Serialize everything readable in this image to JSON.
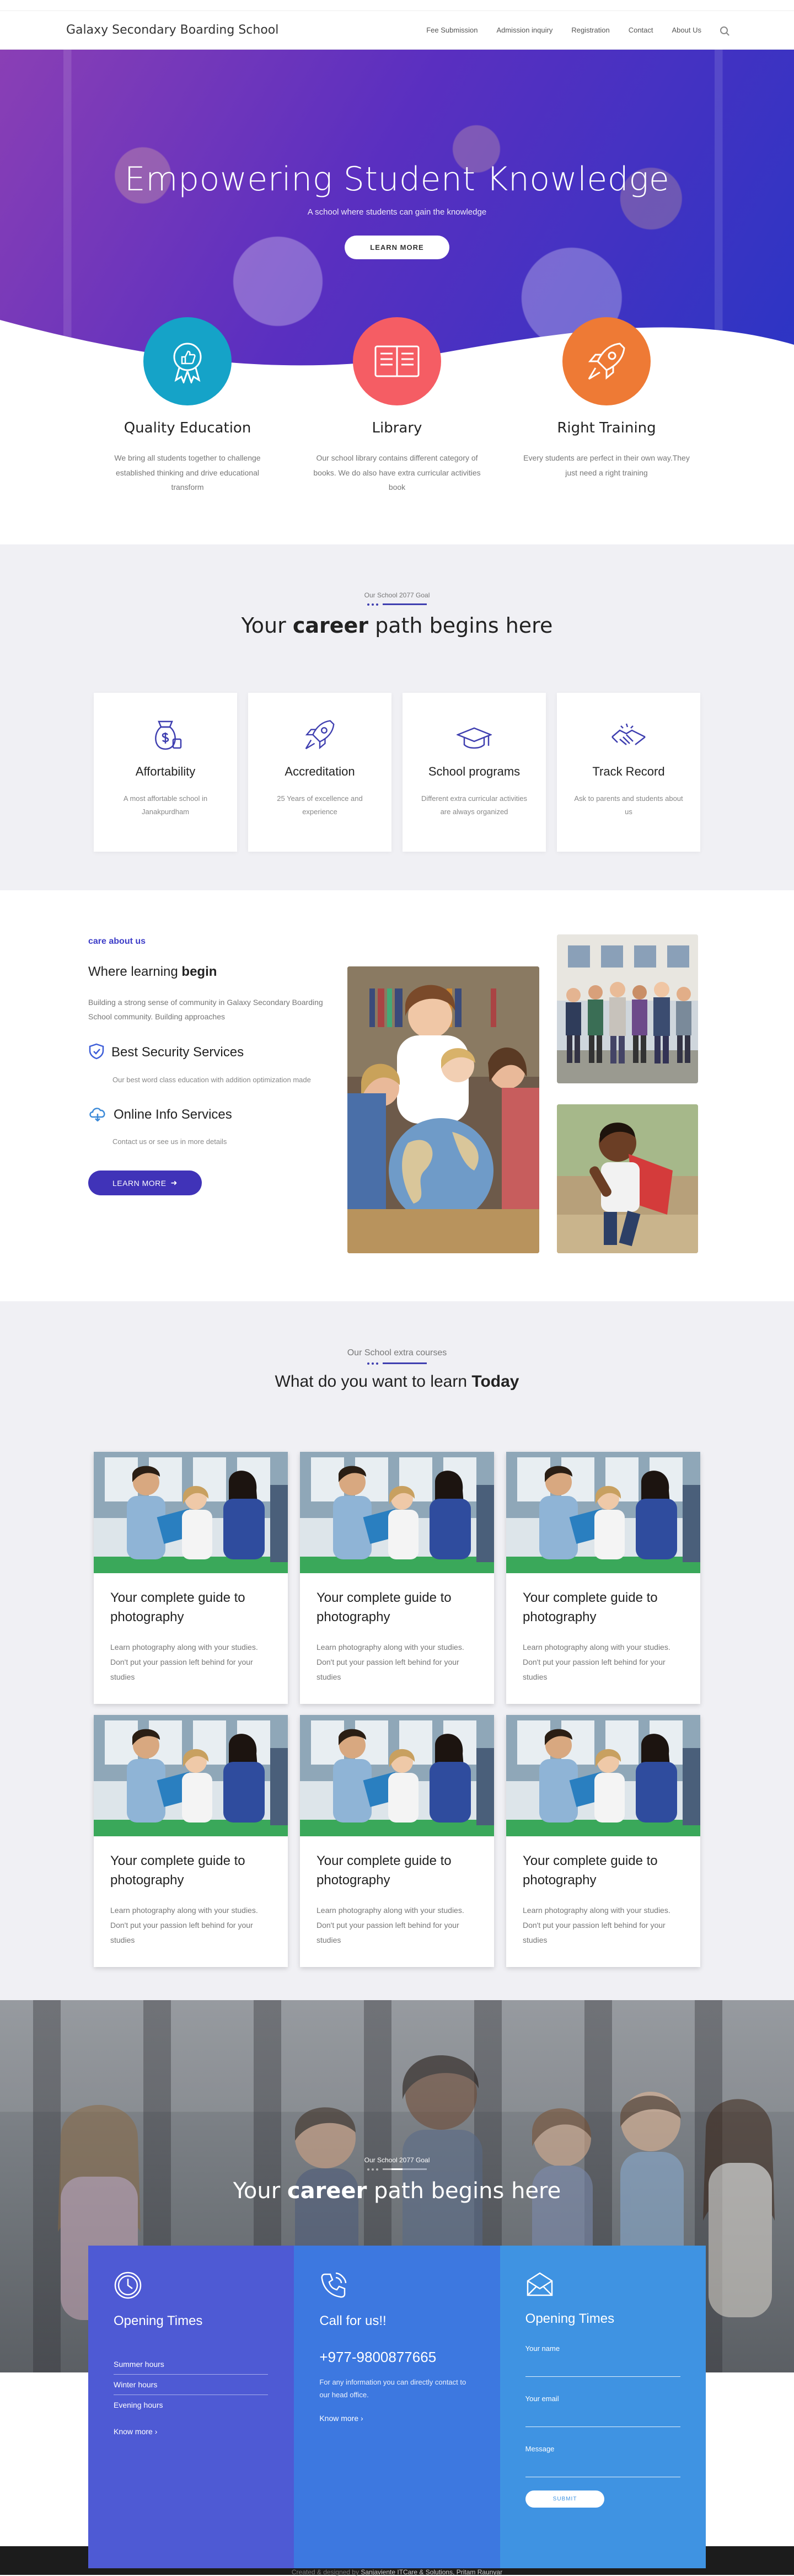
{
  "nav": {
    "brand": "Galaxy Secondary Boarding School",
    "items": [
      "Fee Submission",
      "Admission inquiry",
      "Registration",
      "Contact",
      "About Us"
    ]
  },
  "hero": {
    "title": "Empowering Student Knowledge",
    "subtitle": "A school where students can gain the knowledge",
    "button": "LEARN MORE"
  },
  "features": [
    {
      "title": "Quality Education",
      "text": "We bring all students together to challenge established thinking and drive educational transform",
      "color": "#15a3c8",
      "icon": "badge-thumbs-up-icon"
    },
    {
      "title": "Library",
      "text": "Our school library contains different category of books. We do also have extra curricular activities book",
      "color": "#f55d64",
      "icon": "book-icon"
    },
    {
      "title": "Right Training",
      "text": "Every students are perfect in their own way.They just need a right training",
      "color": "#ee7a35",
      "icon": "rocket-icon"
    }
  ],
  "career": {
    "kicker": "Our School 2077 Goal",
    "title_pre": "Your ",
    "title_bold": "career",
    "title_post": " path begins here",
    "cards": [
      {
        "title": "Affortability",
        "text": "A most affortable school in Janakpurdham",
        "icon": "money-bag-icon"
      },
      {
        "title": "Accreditation",
        "text": "25 Years of excellence and experience",
        "icon": "rocket-icon"
      },
      {
        "title": "School programs",
        "text": "Different extra curricular activities are always organized",
        "icon": "graduation-cap-icon"
      },
      {
        "title": "Track Record",
        "text": "Ask to parents and students about us",
        "icon": "handshake-icon"
      }
    ]
  },
  "about": {
    "tag": "care about us",
    "title_pre": "Where learning ",
    "title_bold": "begin",
    "intro": "Building a strong sense of community in Galaxy Secondary Boarding School community. Building approaches",
    "services": [
      {
        "title": "Best Security Services",
        "text": "Our best word class education with addition optimization made",
        "icon": "shield-icon"
      },
      {
        "title": "Online Info Services",
        "text": "Contact us or see us in more details",
        "icon": "cloud-icon"
      }
    ],
    "button": "LEARN MORE"
  },
  "courses": {
    "kicker": "Our School extra courses",
    "title_pre": "What do you want to learn ",
    "title_bold": "Today",
    "items": [
      {
        "title": "Your complete guide to photography",
        "text": "Learn photography along with your studies. Don't put your passion left behind for your studies"
      },
      {
        "title": "Your complete guide to photography",
        "text": "Learn photography along with your studies. Don't put your passion left behind for your studies"
      },
      {
        "title": "Your complete guide to photography",
        "text": "Learn photography along with your studies. Don't put your passion left behind for your studies"
      },
      {
        "title": "Your complete guide to photography",
        "text": "Learn photography along with your studies. Don't put your passion left behind for your studies"
      },
      {
        "title": "Your complete guide to photography",
        "text": "Learn photography along with your studies. Don't put your passion left behind for your studies"
      },
      {
        "title": "Your complete guide to photography",
        "text": "Learn photography along with your studies. Don't put your passion left behind for your studies"
      }
    ]
  },
  "banner": {
    "kicker": "Our School 2077 Goal",
    "title_pre": "Your ",
    "title_bold": "career",
    "title_post": " path begins here"
  },
  "contact": {
    "hours_title": "Opening Times",
    "hours": [
      "Summer hours",
      "Winter hours",
      "Evening hours"
    ],
    "hours_link": "Know more",
    "call_title": "Call for us!!",
    "phone": "+977-9800877665",
    "call_text": "For any information you can directly contact to our head office.",
    "call_link": "Know more",
    "form_title": "Opening Times",
    "fields": [
      "Your name",
      "Your email",
      "Message"
    ],
    "submit": "SUBMIT"
  },
  "footer": {
    "prefix": "Created & designed by ",
    "credit": "Sanjaviente ITCare & Solutions, Pritam Raunyar"
  }
}
